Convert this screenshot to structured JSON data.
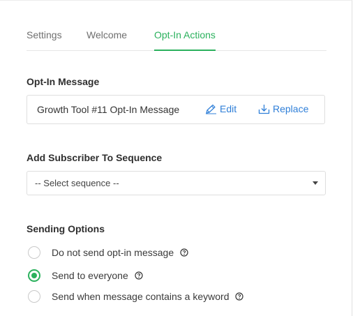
{
  "tabs": [
    {
      "label": "Settings",
      "active": false
    },
    {
      "label": "Welcome",
      "active": false
    },
    {
      "label": "Opt-In Actions",
      "active": true
    }
  ],
  "optin": {
    "section_label": "Opt-In Message",
    "message_name": "Growth Tool #11 Opt-In Message",
    "edit_label": "Edit",
    "replace_label": "Replace"
  },
  "sequence": {
    "section_label": "Add Subscriber To Sequence",
    "selected": "-- Select sequence --"
  },
  "sending": {
    "section_label": "Sending Options",
    "options": [
      {
        "label": "Do not send opt-in message",
        "checked": false
      },
      {
        "label": "Send to everyone",
        "checked": true
      },
      {
        "label": "Send when message contains a keyword",
        "checked": false
      }
    ]
  },
  "colors": {
    "accent": "#2bb15d",
    "link": "#2f7fd8"
  },
  "icons": {
    "edit": "pencil-icon",
    "replace": "download-icon",
    "help": "question-circle-icon",
    "dropdown": "caret-down-icon"
  }
}
